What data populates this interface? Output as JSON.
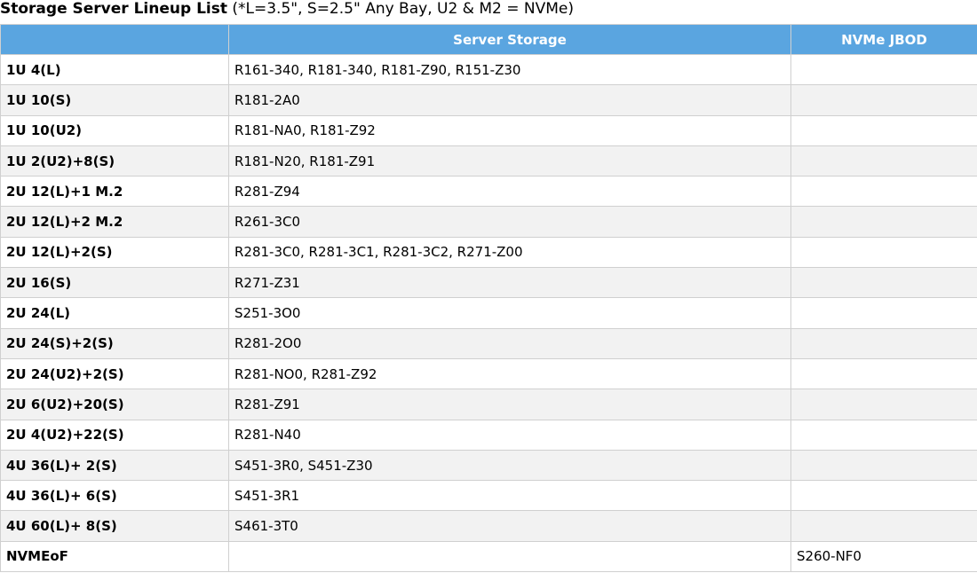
{
  "title": {
    "bold": "Storage Server Lineup List",
    "note": " (*L=3.5\", S=2.5\" Any Bay, U2 & M2 = NVMe)"
  },
  "table": {
    "headers": [
      "",
      "Server Storage",
      "NVMe JBOD"
    ],
    "rows": [
      {
        "config": "1U 4(L)",
        "storage": "R161-340, R181-340, R181-Z90, R151-Z30",
        "jbod": ""
      },
      {
        "config": "1U 10(S)",
        "storage": "R181-2A0",
        "jbod": ""
      },
      {
        "config": "1U 10(U2)",
        "storage": "R181-NA0, R181-Z92",
        "jbod": ""
      },
      {
        "config": "1U 2(U2)+8(S)",
        "storage": "R181-N20, R181-Z91",
        "jbod": ""
      },
      {
        "config": "2U 12(L)+1 M.2",
        "storage": "R281-Z94",
        "jbod": ""
      },
      {
        "config": "2U 12(L)+2 M.2",
        "storage": "R261-3C0",
        "jbod": ""
      },
      {
        "config": "2U 12(L)+2(S)",
        "storage": "R281-3C0, R281-3C1, R281-3C2, R271-Z00",
        "jbod": ""
      },
      {
        "config": "2U 16(S)",
        "storage": "R271-Z31",
        "jbod": ""
      },
      {
        "config": "2U 24(L)",
        "storage": "S251-3O0",
        "jbod": ""
      },
      {
        "config": "2U 24(S)+2(S)",
        "storage": "R281-2O0",
        "jbod": ""
      },
      {
        "config": "2U 24(U2)+2(S)",
        "storage": "R281-NO0, R281-Z92",
        "jbod": ""
      },
      {
        "config": "2U 6(U2)+20(S)",
        "storage": "R281-Z91",
        "jbod": ""
      },
      {
        "config": "2U 4(U2)+22(S)",
        "storage": "R281-N40",
        "jbod": ""
      },
      {
        "config": "4U 36(L)+ 2(S)",
        "storage": "S451-3R0, S451-Z30",
        "jbod": ""
      },
      {
        "config": "4U 36(L)+ 6(S)",
        "storage": "S451-3R1",
        "jbod": ""
      },
      {
        "config": "4U 60(L)+ 8(S)",
        "storage": "S461-3T0",
        "jbod": ""
      },
      {
        "config": "NVMEoF",
        "storage": "",
        "jbod": "S260-NF0"
      }
    ]
  }
}
